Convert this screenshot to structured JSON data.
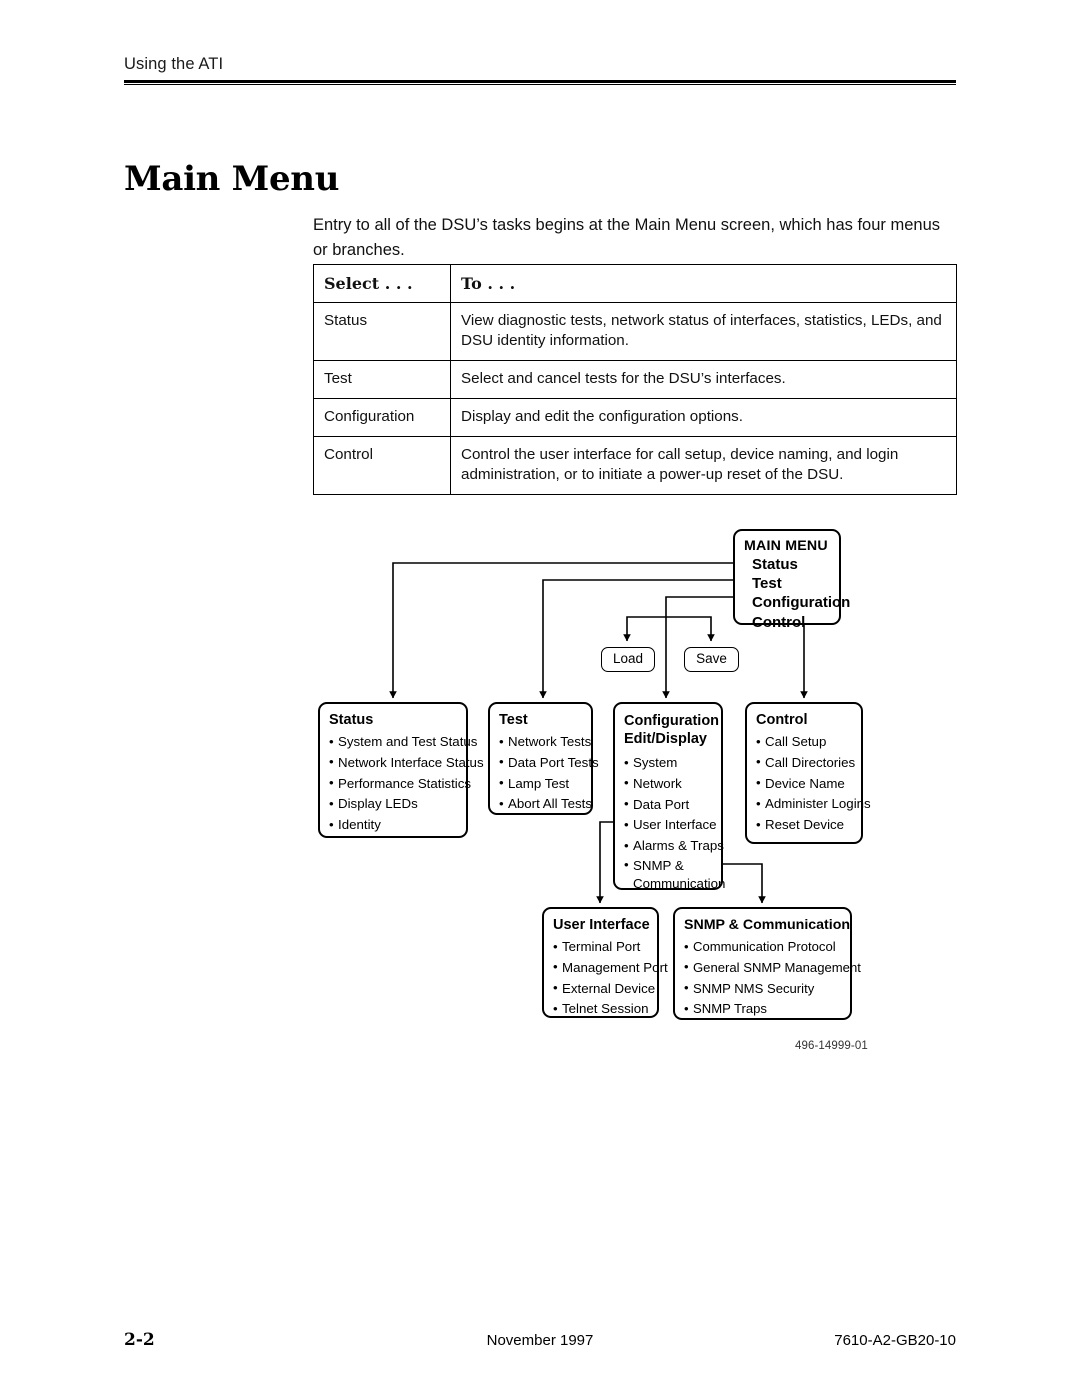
{
  "header": {
    "running_head": "Using the ATI"
  },
  "title": "Main Menu",
  "intro": "Entry to all of the DSU’s tasks begins at the Main Menu screen, which has four menus or branches.",
  "table": {
    "columns": [
      "Select . . .",
      "To . . ."
    ],
    "rows": [
      {
        "select": "Status",
        "to": "View diagnostic tests, network status of interfaces, statistics, LEDs, and DSU identity information."
      },
      {
        "select": "Test",
        "to": "Select and cancel tests for the DSU’s interfaces."
      },
      {
        "select": "Configuration",
        "to": "Display and edit the configuration options."
      },
      {
        "select": "Control",
        "to": "Control the user interface for call setup, device naming, and login administration, or to initiate a power-up reset of the DSU."
      }
    ]
  },
  "diagram": {
    "main_menu": {
      "title": "MAIN MENU",
      "items": [
        "Status",
        "Test",
        "Configuration",
        "Control"
      ]
    },
    "pills": {
      "load": "Load",
      "save": "Save"
    },
    "status": {
      "title": "Status",
      "items": [
        "System and Test Status",
        "Network Interface Status",
        "Performance Statistics",
        "Display LEDs",
        "Identity"
      ]
    },
    "test": {
      "title": "Test",
      "items": [
        "Network Tests",
        "Data Port Tests",
        "Lamp Test",
        "Abort All Tests"
      ]
    },
    "configuration": {
      "title_line1": "Configuration",
      "title_line2": "Edit/Display",
      "items": [
        "System",
        "Network",
        "Data Port",
        "User Interface",
        "Alarms & Traps",
        "SNMP & Communication"
      ]
    },
    "control": {
      "title": "Control",
      "items": [
        "Call Setup",
        "Call Directories",
        "Device Name",
        "Administer Logins",
        "Reset Device"
      ]
    },
    "user_interface": {
      "title": "User Interface",
      "items": [
        "Terminal Port",
        "Management Port",
        "External Device",
        "Telnet Session"
      ]
    },
    "snmp_communication": {
      "title": "SNMP & Communication",
      "items": [
        "Communication Protocol",
        "General SNMP Management",
        "SNMP NMS Security",
        "SNMP Traps"
      ]
    },
    "figure_id": "496-14999-01"
  },
  "footer": {
    "page_number": "2-2",
    "date": "November 1997",
    "doc_number": "7610-A2-GB20-10"
  }
}
